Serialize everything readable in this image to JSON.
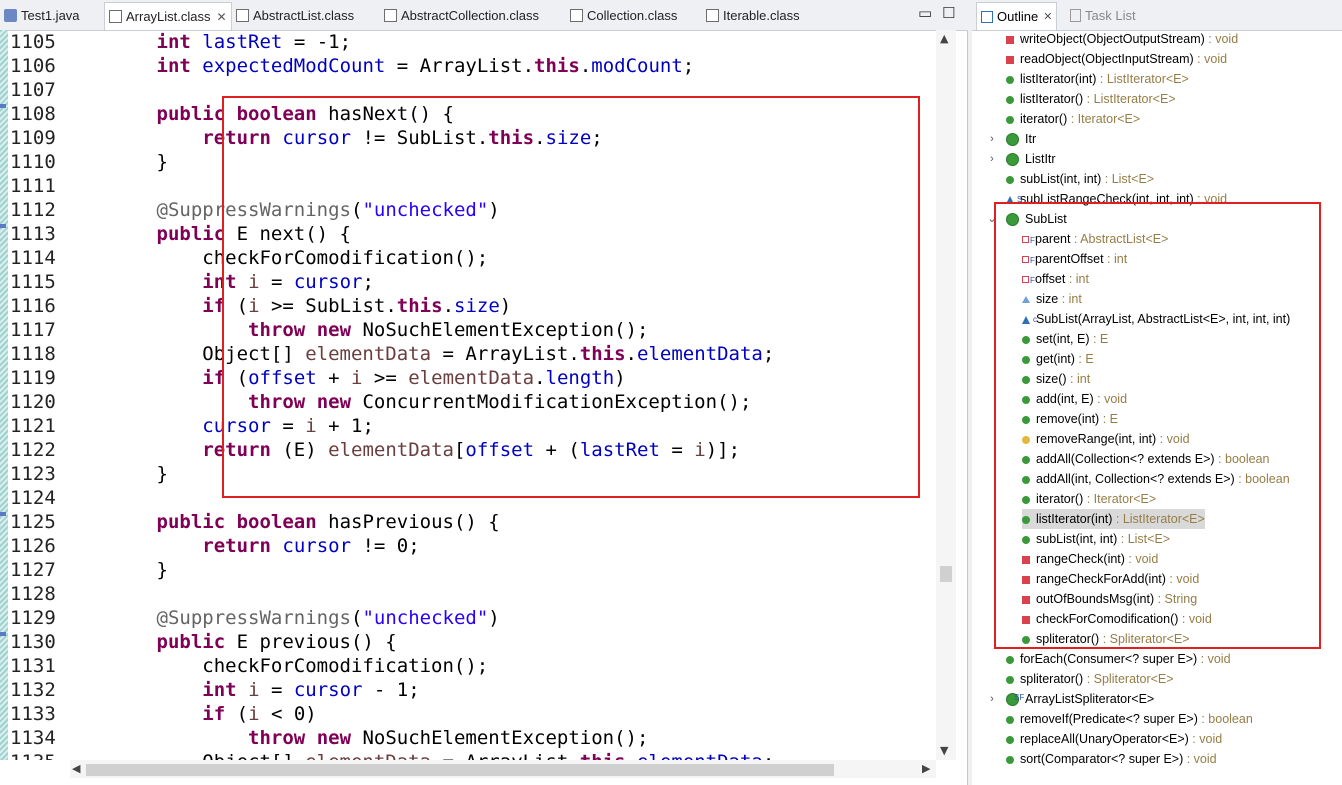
{
  "editor": {
    "tabs": [
      {
        "label": "Test1.java",
        "kind": "java"
      },
      {
        "label": "ArrayList.class",
        "kind": "class",
        "active": true
      },
      {
        "label": "AbstractList.class",
        "kind": "class"
      },
      {
        "label": "AbstractCollection.class",
        "kind": "class"
      },
      {
        "label": "Collection.class",
        "kind": "class"
      },
      {
        "label": "Iterable.class",
        "kind": "class"
      }
    ],
    "close_glyph": "✕",
    "minimize_glyph": "▭",
    "maximize_glyph": "☐",
    "lines": [
      {
        "n": "1105",
        "t": [
          [
            "",
            "        "
          ],
          [
            "kw",
            "int"
          ],
          [
            "",
            " "
          ],
          [
            "fld",
            "lastRet"
          ],
          [
            "",
            " = -1;"
          ]
        ]
      },
      {
        "n": "1106",
        "t": [
          [
            "",
            "        "
          ],
          [
            "kw",
            "int"
          ],
          [
            "",
            " "
          ],
          [
            "fld",
            "expectedModCount"
          ],
          [
            "",
            " = ArrayList."
          ],
          [
            "kw",
            "this"
          ],
          [
            "",
            "."
          ],
          [
            "fld",
            "modCount"
          ],
          [
            "",
            ";"
          ]
        ]
      },
      {
        "n": "1107",
        "t": []
      },
      {
        "n": "1108",
        "t": [
          [
            "",
            "        "
          ],
          [
            "kw",
            "public"
          ],
          [
            "",
            " "
          ],
          [
            "kw",
            "boolean"
          ],
          [
            "",
            " hasNext() {"
          ]
        ]
      },
      {
        "n": "1109",
        "t": [
          [
            "",
            "            "
          ],
          [
            "kw",
            "return"
          ],
          [
            "",
            " "
          ],
          [
            "fld",
            "cursor"
          ],
          [
            "",
            " != SubList."
          ],
          [
            "kw",
            "this"
          ],
          [
            "",
            "."
          ],
          [
            "fld",
            "size"
          ],
          [
            "",
            ";"
          ]
        ]
      },
      {
        "n": "1110",
        "t": [
          [
            "",
            "        }"
          ]
        ]
      },
      {
        "n": "1111",
        "t": []
      },
      {
        "n": "1112",
        "t": [
          [
            "",
            "        "
          ],
          [
            "ann",
            "@SuppressWarnings"
          ],
          [
            "",
            "("
          ],
          [
            "str",
            "\"unchecked\""
          ],
          [
            "",
            ")"
          ]
        ]
      },
      {
        "n": "1113",
        "t": [
          [
            "",
            "        "
          ],
          [
            "kw",
            "public"
          ],
          [
            "",
            " E next() {"
          ]
        ]
      },
      {
        "n": "1114",
        "t": [
          [
            "",
            "            checkForComodification();"
          ]
        ]
      },
      {
        "n": "1115",
        "t": [
          [
            "",
            "            "
          ],
          [
            "kw",
            "int"
          ],
          [
            "",
            " "
          ],
          [
            "var",
            "i"
          ],
          [
            "",
            " = "
          ],
          [
            "fld",
            "cursor"
          ],
          [
            "",
            ";"
          ]
        ]
      },
      {
        "n": "1116",
        "t": [
          [
            "",
            "            "
          ],
          [
            "kw",
            "if"
          ],
          [
            "",
            " ("
          ],
          [
            "var",
            "i"
          ],
          [
            "",
            " >= SubList."
          ],
          [
            "kw",
            "this"
          ],
          [
            "",
            "."
          ],
          [
            "fld",
            "size"
          ],
          [
            "",
            ")"
          ]
        ]
      },
      {
        "n": "1117",
        "t": [
          [
            "",
            "                "
          ],
          [
            "kw",
            "throw"
          ],
          [
            "",
            " "
          ],
          [
            "kw",
            "new"
          ],
          [
            "",
            " NoSuchElementException();"
          ]
        ]
      },
      {
        "n": "1118",
        "t": [
          [
            "",
            "            Object[] "
          ],
          [
            "var",
            "elementData"
          ],
          [
            "",
            " = ArrayList."
          ],
          [
            "kw",
            "this"
          ],
          [
            "",
            "."
          ],
          [
            "fld",
            "elementData"
          ],
          [
            "",
            ";"
          ]
        ]
      },
      {
        "n": "1119",
        "t": [
          [
            "",
            "            "
          ],
          [
            "kw",
            "if"
          ],
          [
            "",
            " ("
          ],
          [
            "fld",
            "offset"
          ],
          [
            "",
            " + "
          ],
          [
            "var",
            "i"
          ],
          [
            "",
            " >= "
          ],
          [
            "var",
            "elementData"
          ],
          [
            "",
            "."
          ],
          [
            "fld",
            "length"
          ],
          [
            "",
            ")"
          ]
        ]
      },
      {
        "n": "1120",
        "t": [
          [
            "",
            "                "
          ],
          [
            "kw",
            "throw"
          ],
          [
            "",
            " "
          ],
          [
            "kw",
            "new"
          ],
          [
            "",
            " ConcurrentModificationException();"
          ]
        ]
      },
      {
        "n": "1121",
        "t": [
          [
            "",
            "            "
          ],
          [
            "fld",
            "cursor"
          ],
          [
            "",
            " = "
          ],
          [
            "var",
            "i"
          ],
          [
            "",
            " + 1;"
          ]
        ]
      },
      {
        "n": "1122",
        "t": [
          [
            "",
            "            "
          ],
          [
            "kw",
            "return"
          ],
          [
            "",
            " (E) "
          ],
          [
            "var",
            "elementData"
          ],
          [
            "",
            "["
          ],
          [
            "fld",
            "offset"
          ],
          [
            "",
            " + ("
          ],
          [
            "fld",
            "lastRet"
          ],
          [
            "",
            " = "
          ],
          [
            "var",
            "i"
          ],
          [
            "",
            ")];"
          ]
        ]
      },
      {
        "n": "1123",
        "t": [
          [
            "",
            "        }"
          ]
        ]
      },
      {
        "n": "1124",
        "t": []
      },
      {
        "n": "1125",
        "t": [
          [
            "",
            "        "
          ],
          [
            "kw",
            "public"
          ],
          [
            "",
            " "
          ],
          [
            "kw",
            "boolean"
          ],
          [
            "",
            " hasPrevious() {"
          ]
        ]
      },
      {
        "n": "1126",
        "t": [
          [
            "",
            "            "
          ],
          [
            "kw",
            "return"
          ],
          [
            "",
            " "
          ],
          [
            "fld",
            "cursor"
          ],
          [
            "",
            " != 0;"
          ]
        ]
      },
      {
        "n": "1127",
        "t": [
          [
            "",
            "        }"
          ]
        ]
      },
      {
        "n": "1128",
        "t": []
      },
      {
        "n": "1129",
        "t": [
          [
            "",
            "        "
          ],
          [
            "ann",
            "@SuppressWarnings"
          ],
          [
            "",
            "("
          ],
          [
            "str",
            "\"unchecked\""
          ],
          [
            "",
            ")"
          ]
        ]
      },
      {
        "n": "1130",
        "t": [
          [
            "",
            "        "
          ],
          [
            "kw",
            "public"
          ],
          [
            "",
            " E previous() {"
          ]
        ]
      },
      {
        "n": "1131",
        "t": [
          [
            "",
            "            checkForComodification();"
          ]
        ]
      },
      {
        "n": "1132",
        "t": [
          [
            "",
            "            "
          ],
          [
            "kw",
            "int"
          ],
          [
            "",
            " "
          ],
          [
            "var",
            "i"
          ],
          [
            "",
            " = "
          ],
          [
            "fld",
            "cursor"
          ],
          [
            "",
            " - 1;"
          ]
        ]
      },
      {
        "n": "1133",
        "t": [
          [
            "",
            "            "
          ],
          [
            "kw",
            "if"
          ],
          [
            "",
            " ("
          ],
          [
            "var",
            "i"
          ],
          [
            "",
            " < 0)"
          ]
        ]
      },
      {
        "n": "1134",
        "t": [
          [
            "",
            "                "
          ],
          [
            "kw",
            "throw"
          ],
          [
            "",
            " "
          ],
          [
            "kw",
            "new"
          ],
          [
            "",
            " NoSuchElementException();"
          ]
        ]
      },
      {
        "n": "1135",
        "t": [
          [
            "",
            "            Object[] "
          ],
          [
            "var",
            "elementData"
          ],
          [
            "",
            " = ArrayList."
          ],
          [
            "kw",
            "this"
          ],
          [
            "",
            "."
          ],
          [
            "fld",
            "elementData"
          ],
          [
            "",
            ";"
          ]
        ]
      }
    ]
  },
  "outline": {
    "tab_label": "Outline",
    "tab_close": "✕",
    "task_tab_label": "Task List",
    "rows": [
      {
        "indent": 0,
        "icon": "priv",
        "name": "writeObject(ObjectOutputStream)",
        "type": " : void"
      },
      {
        "indent": 0,
        "icon": "priv",
        "name": "readObject(ObjectInputStream)",
        "type": " : void"
      },
      {
        "indent": 0,
        "icon": "pub",
        "name": "listIterator(int)",
        "type": " : ListIterator<E>"
      },
      {
        "indent": 0,
        "icon": "pub",
        "name": "listIterator()",
        "type": " : ListIterator<E>"
      },
      {
        "indent": 0,
        "icon": "pub",
        "name": "iterator()",
        "type": " : Iterator<E>"
      },
      {
        "indent": 0,
        "icon": "class",
        "twisty": "›",
        "name": "Itr",
        "type": ""
      },
      {
        "indent": 0,
        "icon": "class",
        "twisty": "›",
        "name": "ListItr",
        "type": ""
      },
      {
        "indent": 0,
        "icon": "pub",
        "name": "subList(int, int)",
        "type": " : List<E>"
      },
      {
        "indent": 0,
        "icon": "pkg",
        "sup": "S",
        "name": "subListRangeCheck(int, int, int)",
        "type": " : void"
      },
      {
        "indent": 0,
        "icon": "class",
        "twisty": "⌄",
        "name": "SubList",
        "type": ""
      },
      {
        "indent": 1,
        "icon": "fpriv",
        "sup": "F",
        "name": "parent",
        "type": " : AbstractList<E>"
      },
      {
        "indent": 1,
        "icon": "fpriv",
        "sup": "F",
        "name": "parentOffset",
        "type": " : int"
      },
      {
        "indent": 1,
        "icon": "fpriv",
        "sup": "F",
        "name": "offset",
        "type": " : int"
      },
      {
        "indent": 1,
        "icon": "pkgo",
        "name": "size",
        "type": " : int"
      },
      {
        "indent": 1,
        "icon": "pkg",
        "sup": "c",
        "name": "SubList(ArrayList, AbstractList<E>, int, int, int)",
        "type": ""
      },
      {
        "indent": 1,
        "icon": "pub",
        "name": "set(int, E)",
        "type": " : E"
      },
      {
        "indent": 1,
        "icon": "pub",
        "name": "get(int)",
        "type": " : E"
      },
      {
        "indent": 1,
        "icon": "pub",
        "name": "size()",
        "type": " : int"
      },
      {
        "indent": 1,
        "icon": "pub",
        "name": "add(int, E)",
        "type": " : void"
      },
      {
        "indent": 1,
        "icon": "pub",
        "name": "remove(int)",
        "type": " : E"
      },
      {
        "indent": 1,
        "icon": "prot",
        "name": "removeRange(int, int)",
        "type": " : void"
      },
      {
        "indent": 1,
        "icon": "pub",
        "name": "addAll(Collection<? extends E>)",
        "type": " : boolean"
      },
      {
        "indent": 1,
        "icon": "pub",
        "name": "addAll(int, Collection<? extends E>)",
        "type": " : boolean"
      },
      {
        "indent": 1,
        "icon": "pub",
        "name": "iterator()",
        "type": " : Iterator<E>"
      },
      {
        "indent": 1,
        "icon": "pub",
        "name": "listIterator(int)",
        "type": " : ListIterator<E>",
        "selected": true
      },
      {
        "indent": 1,
        "icon": "pub",
        "name": "subList(int, int)",
        "type": " : List<E>"
      },
      {
        "indent": 1,
        "icon": "priv",
        "name": "rangeCheck(int)",
        "type": " : void"
      },
      {
        "indent": 1,
        "icon": "priv",
        "name": "rangeCheckForAdd(int)",
        "type": " : void"
      },
      {
        "indent": 1,
        "icon": "priv",
        "name": "outOfBoundsMsg(int)",
        "type": " : String"
      },
      {
        "indent": 1,
        "icon": "priv",
        "name": "checkForComodification()",
        "type": " : void"
      },
      {
        "indent": 1,
        "icon": "pub",
        "name": "spliterator()",
        "type": " : Spliterator<E>"
      },
      {
        "indent": 0,
        "icon": "pub",
        "name": "forEach(Consumer<? super E>)",
        "type": " : void"
      },
      {
        "indent": 0,
        "icon": "pub",
        "name": "spliterator()",
        "type": " : Spliterator<E>"
      },
      {
        "indent": 0,
        "icon": "class",
        "twisty": "›",
        "sup": "SF",
        "name": "ArrayListSpliterator<E>",
        "type": ""
      },
      {
        "indent": 0,
        "icon": "pub",
        "name": "removeIf(Predicate<? super E>)",
        "type": " : boolean"
      },
      {
        "indent": 0,
        "icon": "pub",
        "name": "replaceAll(UnaryOperator<E>)",
        "type": " : void"
      },
      {
        "indent": 0,
        "icon": "pub",
        "name": "sort(Comparator<? super E>)",
        "type": " : void"
      }
    ]
  },
  "colors": {
    "highlight_box": "#e02020",
    "keyword": "#7f0055",
    "field": "#0000c0",
    "string": "#2a00ff"
  }
}
